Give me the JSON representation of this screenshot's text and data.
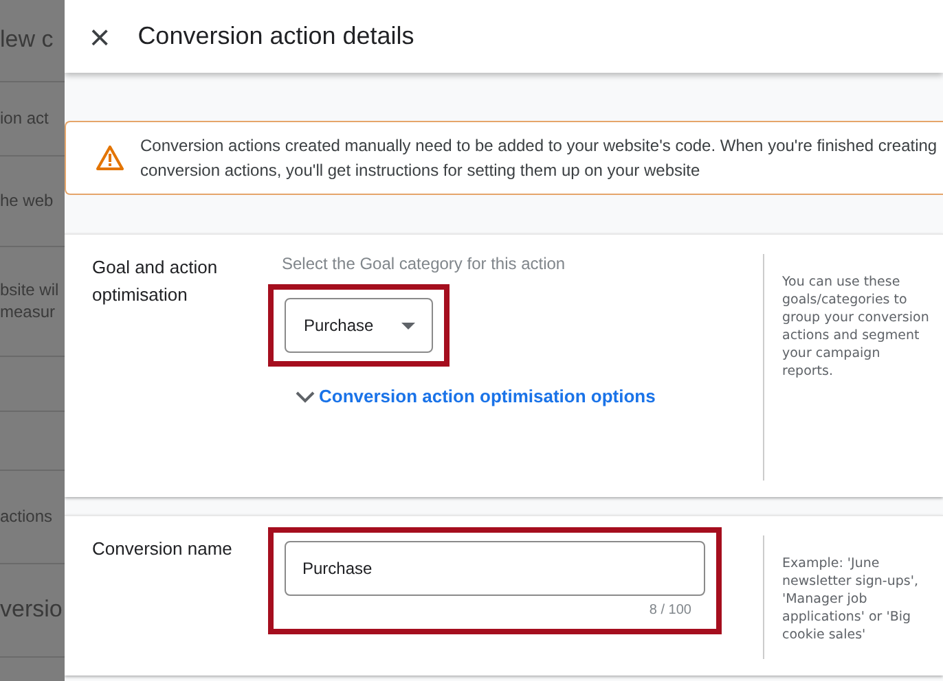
{
  "background_page": {
    "items": [
      {
        "kind": "heading",
        "text": "lew c"
      },
      {
        "kind": "row",
        "text": "ion act"
      },
      {
        "kind": "row",
        "text": "he web"
      },
      {
        "kind": "lines",
        "lines": [
          "bsite wil",
          "measur"
        ]
      },
      {
        "kind": "blank"
      },
      {
        "kind": "blank"
      },
      {
        "kind": "row",
        "text": "actions"
      },
      {
        "kind": "heading",
        "text": "versio"
      }
    ]
  },
  "panel": {
    "title": "Conversion action details",
    "close": "×"
  },
  "warning": "Conversion actions created manually need to be added to your website's code. When you're finished creating conversion actions, you'll get instructions for setting them up on your website",
  "sections": [
    {
      "kind": "goal",
      "label": "Goal and action optimisation",
      "hint": "Select the Goal category for this action",
      "dropdown": "Purchase",
      "highlighted": true,
      "expander": {
        "label": "Conversion action optimisation options",
        "expanded": false
      },
      "help": "You can use these goals/categories to group your conversion actions and segment your campaign reports."
    },
    {
      "kind": "name",
      "label": "Conversion name",
      "value": "Purchase",
      "counter": "8 / 100",
      "highlighted": true,
      "help": "Example: 'June newsletter sign-ups', 'Manager job applications' or 'Big cookie sales'"
    }
  ]
}
